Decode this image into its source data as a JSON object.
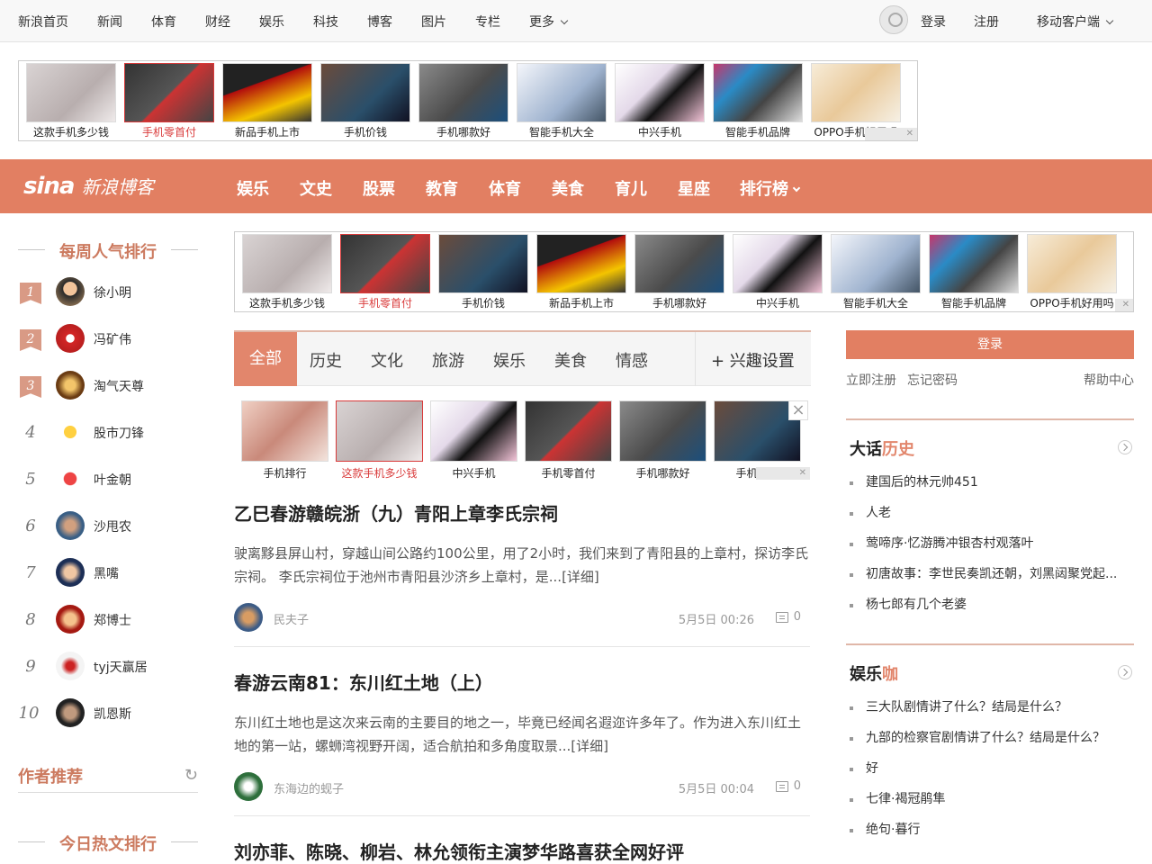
{
  "topnav": {
    "items": [
      "新浪首页",
      "新闻",
      "体育",
      "财经",
      "娱乐",
      "科技",
      "博客",
      "图片",
      "专栏",
      "更多"
    ],
    "login": "登录",
    "register": "注册",
    "mobile": "移动客户端"
  },
  "ad_top": {
    "items": [
      "这款手机多少钱",
      "手机零首付",
      "新品手机上市",
      "手机价钱",
      "手机哪款好",
      "智能手机大全",
      "中兴手机",
      "智能手机品牌",
      "OPPO手机好用吗"
    ],
    "selected_index": 1
  },
  "header": {
    "logo_sina": "sina",
    "logo_text": "新浪博客",
    "categories": [
      "娱乐",
      "文史",
      "股票",
      "教育",
      "体育",
      "美食",
      "育儿",
      "星座",
      "排行榜"
    ]
  },
  "ad_mid": {
    "items": [
      "这款手机多少钱",
      "手机零首付",
      "手机价钱",
      "新品手机上市",
      "手机哪款好",
      "中兴手机",
      "智能手机大全",
      "智能手机品牌",
      "OPPO手机好用吗"
    ],
    "selected_index": 1
  },
  "weekly": {
    "title": "每周人气排行",
    "items": [
      {
        "rank": "1",
        "name": "徐小明"
      },
      {
        "rank": "2",
        "name": "冯矿伟"
      },
      {
        "rank": "3",
        "name": "淘气天尊"
      },
      {
        "rank": "4",
        "name": "股市刀锋"
      },
      {
        "rank": "5",
        "name": "叶金朝"
      },
      {
        "rank": "6",
        "name": "沙甩农"
      },
      {
        "rank": "7",
        "name": "黑嘴"
      },
      {
        "rank": "8",
        "name": "郑博士"
      },
      {
        "rank": "9",
        "name": "tyj天赢居"
      },
      {
        "rank": "10",
        "name": "凯恩斯"
      }
    ]
  },
  "author_recommend": {
    "title": "作者推荐"
  },
  "hot_today": {
    "title": "今日热文排行"
  },
  "tabs": {
    "items": [
      "全部",
      "历史",
      "文化",
      "旅游",
      "娱乐",
      "美食",
      "情感"
    ],
    "interest": "+ 兴趣设置"
  },
  "ad_feed": {
    "items": [
      "手机排行",
      "这款手机多少钱",
      "中兴手机",
      "手机零首付",
      "手机哪款好",
      "手机价钱"
    ],
    "selected_index": 1
  },
  "articles": [
    {
      "title": "乙巳春游赣皖浙（九）青阳上章李氏宗祠",
      "summary": "驶离黟县屏山村，穿越山间公路约100公里，用了2小时，我们来到了青阳县的上章村，探访李氏宗祠。 李氏宗祠位于池州市青阳县沙济乡上章村，是...[详细]",
      "author": "民夫子",
      "time": "5月5日 00:26",
      "comments": "0"
    },
    {
      "title": "春游云南81：东川红土地（上）",
      "summary": "东川红土地也是这次来云南的主要目的地之一，毕竟已经闻名遐迩许多年了。作为进入东川红土地的第一站，螺蛳湾视野开阔，适合航拍和多角度取景...[详细]",
      "author": "东海边的蚬子",
      "time": "5月5日 00:04",
      "comments": "0"
    },
    {
      "title": "刘亦菲、陈晓、柳岩、林允领衔主演梦华路喜获全网好评"
    }
  ],
  "sidebar_right": {
    "login": "登录",
    "register": "立即注册",
    "forgot": "忘记密码",
    "help": "帮助中心",
    "history": {
      "title_a": "大话",
      "title_b": "历史",
      "items": [
        "建国后的林元帅451",
        "人老",
        "莺啼序·忆游腾冲银杏村观落叶",
        "初唐故事：李世民奏凯还朝，刘黑闼聚党起...",
        "杨七郎有几个老婆"
      ]
    },
    "ent": {
      "title_a": "娱乐",
      "title_b": "咖",
      "items": [
        "三大队剧情讲了什么？结局是什么？",
        "九部的检察官剧情讲了什么？结局是什么？",
        "好",
        "七律·褐冠鹃隼",
        "绝句·暮行"
      ]
    }
  },
  "colors": {
    "accent": "#e27f62",
    "ad_selected": "#d93a3a"
  }
}
